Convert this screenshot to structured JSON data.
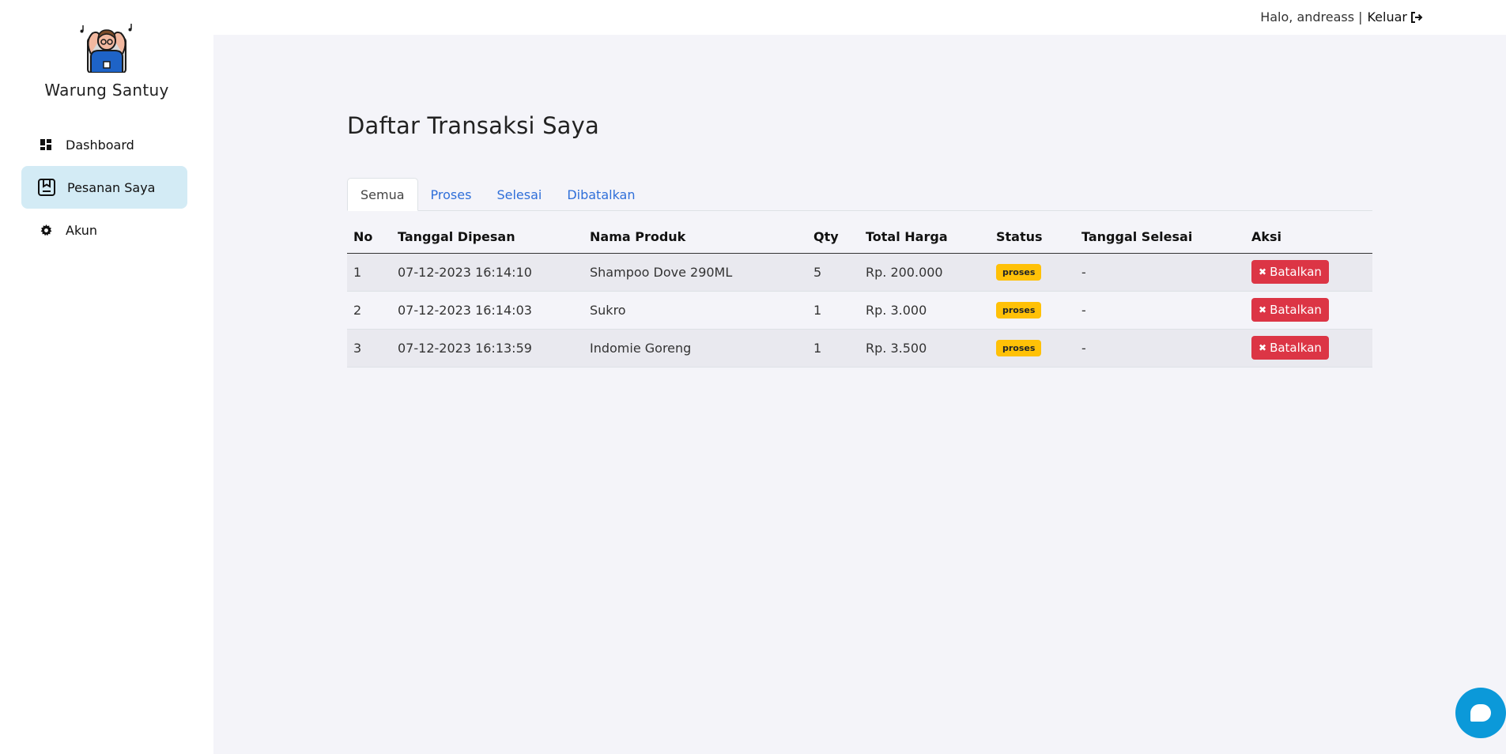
{
  "brand": {
    "name": "Warung Santuy",
    "logo_icon": "relaxing-person-logo"
  },
  "sidebar": {
    "items": [
      {
        "label": "Dashboard",
        "icon": "dashboard-icon"
      },
      {
        "label": "Pesanan Saya",
        "icon": "order-icon",
        "active": true
      },
      {
        "label": "Akun",
        "icon": "gear-icon"
      }
    ]
  },
  "header": {
    "greeting": "Halo, andreass",
    "separator": "|",
    "logout_label": "Keluar",
    "logout_icon": "logout-icon"
  },
  "main": {
    "title": "Daftar Transaksi Saya",
    "tabs": [
      {
        "label": "Semua",
        "active": true
      },
      {
        "label": "Proses"
      },
      {
        "label": "Selesai"
      },
      {
        "label": "Dibatalkan"
      }
    ],
    "table": {
      "headers": [
        "No",
        "Tanggal Dipesan",
        "Nama Produk",
        "Qty",
        "Total Harga",
        "Status",
        "Tanggal Selesai",
        "Aksi"
      ],
      "rows": [
        {
          "no": "1",
          "date": "07-12-2023 16:14:10",
          "product": "Shampoo Dove 290ML",
          "qty": "5",
          "total": "Rp. 200.000",
          "status": "proses",
          "finished": "-",
          "action": "Batalkan"
        },
        {
          "no": "2",
          "date": "07-12-2023 16:14:03",
          "product": "Sukro",
          "qty": "1",
          "total": "Rp. 3.000",
          "status": "proses",
          "finished": "-",
          "action": "Batalkan"
        },
        {
          "no": "3",
          "date": "07-12-2023 16:13:59",
          "product": "Indomie Goreng",
          "qty": "1",
          "total": "Rp. 3.500",
          "status": "proses",
          "finished": "-",
          "action": "Batalkan"
        }
      ]
    }
  },
  "colors": {
    "accent": "#2f6fd9",
    "sidebar_active": "#d3ebf5",
    "danger": "#dc3545",
    "warning": "#ffc107",
    "chat": "#0b99d9",
    "main_bg": "#f4f4f9"
  },
  "chat": {
    "icon": "chat-icon"
  }
}
